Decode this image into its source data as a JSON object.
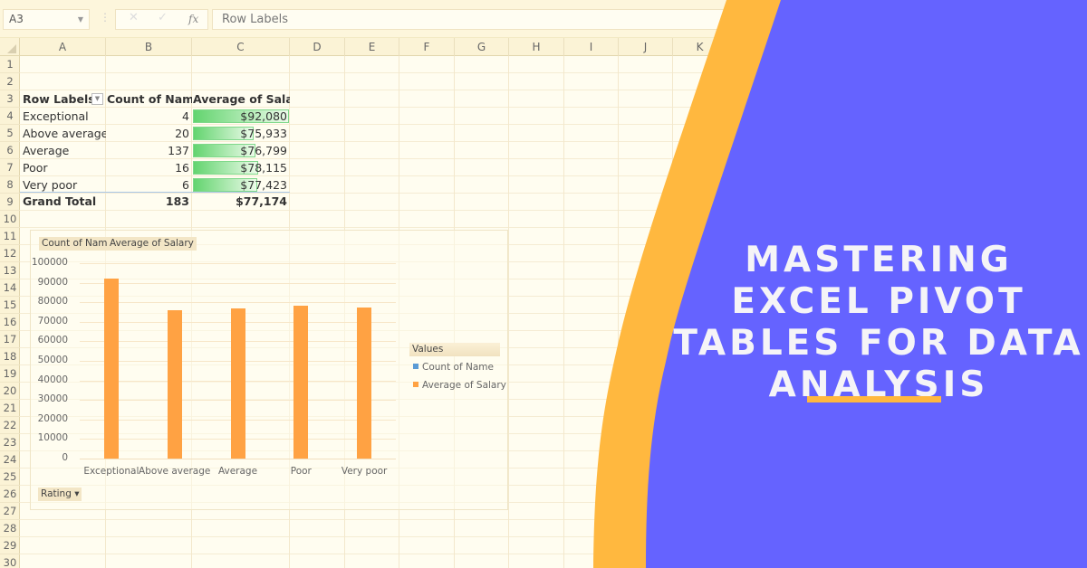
{
  "formula_bar": {
    "name_box": "A3",
    "cancel_icon": "✕",
    "enter_icon": "✓",
    "fx_label": "fx",
    "formula": "Row Labels"
  },
  "columns": [
    "A",
    "B",
    "C",
    "D",
    "E",
    "F",
    "G",
    "H",
    "I",
    "J",
    "K"
  ],
  "rows": [
    "1",
    "2",
    "3",
    "4",
    "5",
    "6",
    "7",
    "8",
    "9",
    "10",
    "11",
    "12",
    "13",
    "14",
    "15",
    "16",
    "17",
    "18",
    "19",
    "20",
    "21",
    "22",
    "23",
    "24",
    "25",
    "26",
    "27",
    "28",
    "29",
    "30"
  ],
  "pivot": {
    "headers": [
      "Row Labels",
      "Count of Name",
      "Average of Salary"
    ],
    "rows": [
      {
        "label": "Exceptional",
        "count": "4",
        "salary": "$92,080",
        "salary_value": 92080
      },
      {
        "label": "Above average",
        "count": "20",
        "salary": "$75,933",
        "salary_value": 75933
      },
      {
        "label": "Average",
        "count": "137",
        "salary": "$76,799",
        "salary_value": 76799
      },
      {
        "label": "Poor",
        "count": "16",
        "salary": "$78,115",
        "salary_value": 78115
      },
      {
        "label": "Very poor",
        "count": "6",
        "salary": "$77,423",
        "salary_value": 77423
      }
    ],
    "total": {
      "label": "Grand Total",
      "count": "183",
      "salary": "$77,174"
    }
  },
  "chart_data": {
    "type": "bar",
    "title": "",
    "field_buttons": [
      "Count of Name",
      "Average of Salary"
    ],
    "axis_field_button": "Rating ▾",
    "categories": [
      "Exceptional",
      "Above average",
      "Average",
      "Poor",
      "Very poor"
    ],
    "series": [
      {
        "name": "Count of Name",
        "color": "#5b9bd5",
        "values": [
          4,
          20,
          137,
          16,
          6
        ]
      },
      {
        "name": "Average of Salary",
        "color": "#ffa243",
        "values": [
          92080,
          75933,
          76799,
          78115,
          77423
        ]
      }
    ],
    "yticks": [
      0,
      10000,
      20000,
      30000,
      40000,
      50000,
      60000,
      70000,
      80000,
      90000,
      100000
    ],
    "ylim": [
      0,
      100000
    ],
    "legend_title": "Values",
    "legend_position": "right",
    "grid": true
  },
  "banner": {
    "title_lines": [
      "MASTERING",
      "EXCEL PIVOT",
      "TABLES FOR DATA",
      "ANALYSIS"
    ],
    "purple": "#6563ff",
    "orange": "#ffb83f",
    "text_color": "#f5f4f7"
  }
}
